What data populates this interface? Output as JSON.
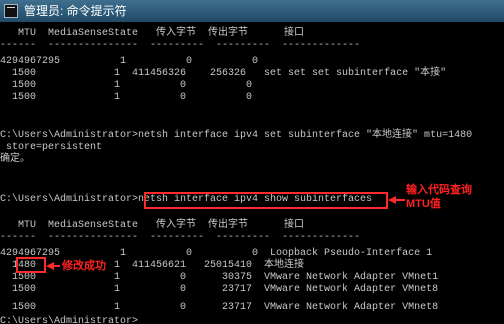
{
  "window": {
    "title": "管理员: 命令提示符"
  },
  "console": {
    "line1": "   MTU  MediaSenseState   传入字节  传出字节      接口",
    "line2": "------  ---------------  ---------  ---------  -------------",
    "line3": "4294967295          1          0          0",
    "line4": "  1500             1  411456326    256326   set set set subinterface \"本接\"",
    "line5": "  1500             1          0          0",
    "line6": "  1500             1          0          0",
    "line7": "C:\\Users\\Administrator>netsh interface ipv4 set subinterface \"本地连接\" mtu=1480",
    "line8": " store=persistent",
    "line9": "确定。",
    "line10": "C:\\Users\\Administrator>netsh interface ipv4 show subinterfaces",
    "line11": "   MTU  MediaSenseState   传入字节  传出字节      接口",
    "line12": "------  ---------------  ---------  ---------  -------------",
    "line13": "4294967295          1          0          0  Loopback Pseudo-Interface 1",
    "line14": "  1480             1  411456621   25015410  本地连接",
    "line15": "  1500             1          0      30375  VMware Network Adapter VMnet1",
    "line16": "  1500             1          0      23717  VMware Network Adapter VMnet8",
    "line17": "  1500             1          0      23717  VMware Network Adapter VMnet8",
    "line18": "C:\\Users\\Administrator>"
  },
  "annotations": {
    "input_code_line1": "输入代码查询",
    "input_code_line2": "MTU值",
    "modify_success": "修改成功"
  },
  "colors": {
    "highlight": "#ff2a2a",
    "annotation_text": "#ff2020",
    "console_text": "#c8c8c8"
  }
}
